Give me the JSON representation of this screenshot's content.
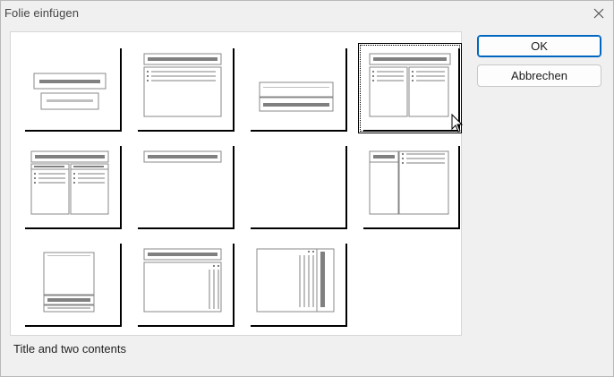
{
  "window": {
    "title": "Folie einfügen"
  },
  "buttons": {
    "ok": "OK",
    "cancel": "Abbrechen"
  },
  "status": {
    "selected_layout": "Title and two contents"
  },
  "layouts_selected_index": 3,
  "icons": {
    "close": "close-icon",
    "pointer": "mouse-pointer-icon"
  },
  "colors": {
    "accent": "#0067c0",
    "bar_dark": "#808080",
    "bar_light": "#bfbfbf"
  }
}
